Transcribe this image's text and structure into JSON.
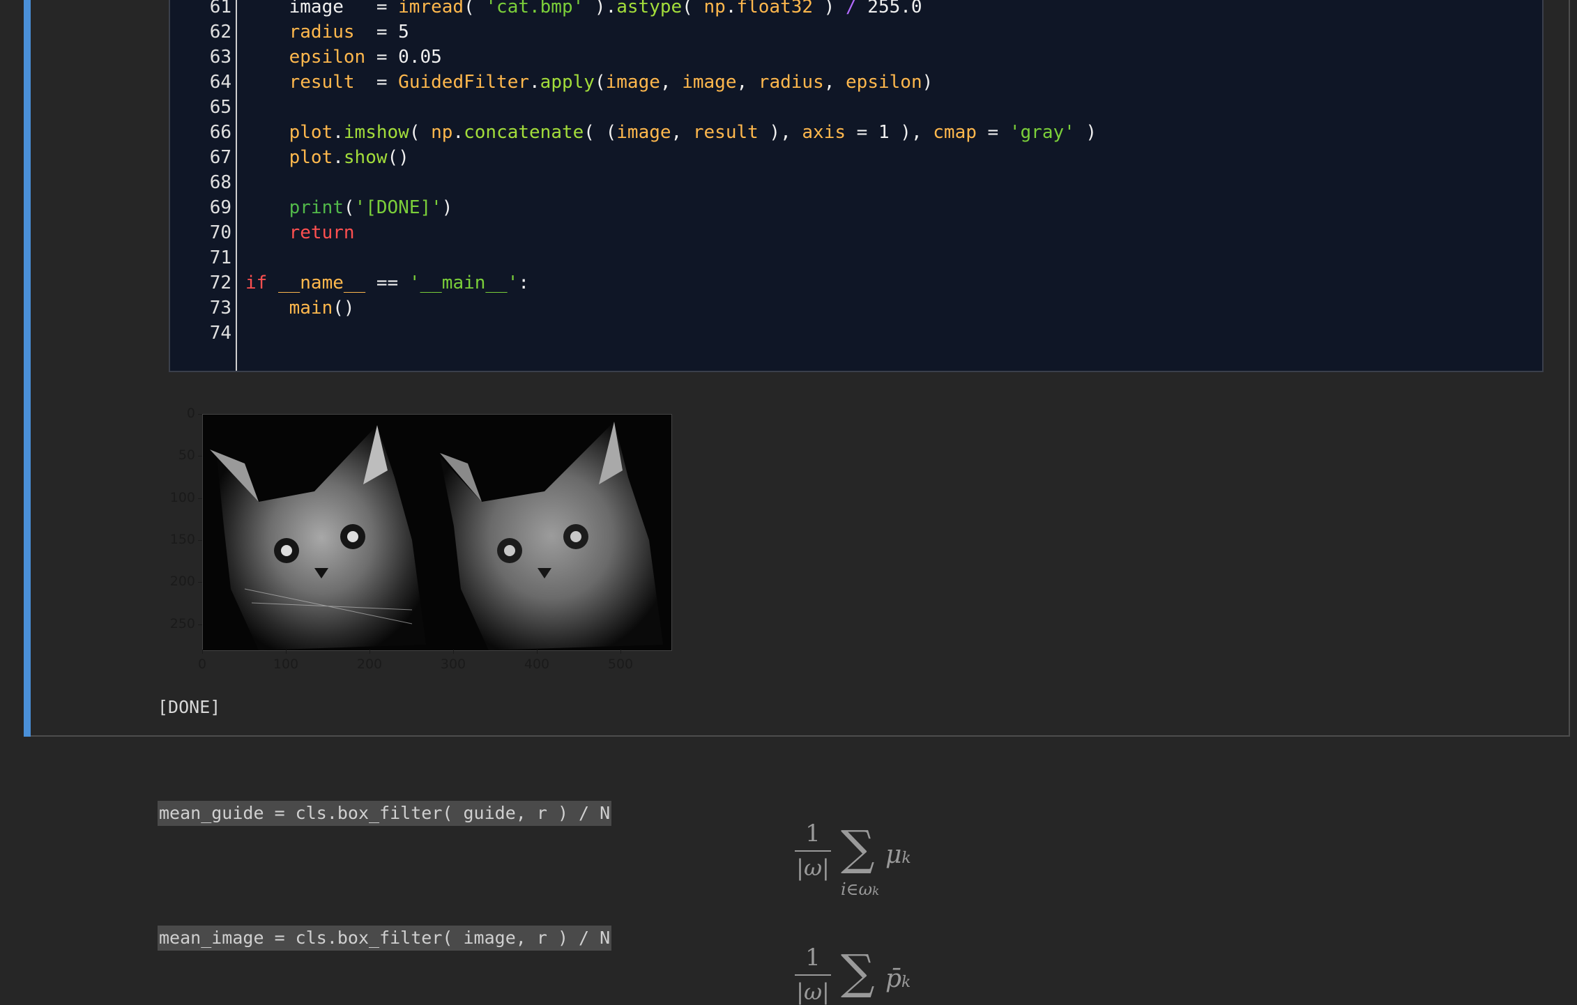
{
  "code": {
    "lines": [
      {
        "num": "61",
        "parts": [
          [
            "w",
            "    image   = "
          ],
          [
            "n",
            "imread"
          ],
          [
            "w",
            "( "
          ],
          [
            "s",
            "'cat.bmp'"
          ],
          [
            "w",
            " )."
          ],
          [
            "f",
            "astype"
          ],
          [
            "w",
            "( "
          ],
          [
            "n",
            "np"
          ],
          [
            "w",
            "."
          ],
          [
            "n",
            "float32"
          ],
          [
            "w",
            " ) "
          ],
          [
            "op",
            "/"
          ],
          [
            "w",
            " 255.0"
          ]
        ]
      },
      {
        "num": "62",
        "parts": [
          [
            "w",
            "    "
          ],
          [
            "n",
            "radius"
          ],
          [
            "w",
            "  = 5"
          ]
        ]
      },
      {
        "num": "63",
        "parts": [
          [
            "w",
            "    "
          ],
          [
            "n",
            "epsilon"
          ],
          [
            "w",
            " = 0.05"
          ]
        ]
      },
      {
        "num": "64",
        "parts": [
          [
            "w",
            "    "
          ],
          [
            "n",
            "result"
          ],
          [
            "w",
            "  = "
          ],
          [
            "n",
            "GuidedFilter"
          ],
          [
            "w",
            "."
          ],
          [
            "f",
            "apply"
          ],
          [
            "w",
            "("
          ],
          [
            "n",
            "image"
          ],
          [
            "w",
            ", "
          ],
          [
            "n",
            "image"
          ],
          [
            "w",
            ", "
          ],
          [
            "n",
            "radius"
          ],
          [
            "w",
            ", "
          ],
          [
            "n",
            "epsilon"
          ],
          [
            "w",
            ")"
          ]
        ]
      },
      {
        "num": "65",
        "parts": []
      },
      {
        "num": "66",
        "parts": [
          [
            "w",
            "    "
          ],
          [
            "n",
            "plot"
          ],
          [
            "w",
            "."
          ],
          [
            "f",
            "imshow"
          ],
          [
            "w",
            "( "
          ],
          [
            "n",
            "np"
          ],
          [
            "w",
            "."
          ],
          [
            "f",
            "concatenate"
          ],
          [
            "w",
            "( ("
          ],
          [
            "n",
            "image"
          ],
          [
            "w",
            ", "
          ],
          [
            "n",
            "result"
          ],
          [
            "w",
            " ), "
          ],
          [
            "n",
            "axis"
          ],
          [
            "w",
            " = 1 ), "
          ],
          [
            "n",
            "cmap"
          ],
          [
            "w",
            " = "
          ],
          [
            "s",
            "'gray'"
          ],
          [
            "w",
            " )"
          ]
        ]
      },
      {
        "num": "67",
        "parts": [
          [
            "w",
            "    "
          ],
          [
            "n",
            "plot"
          ],
          [
            "w",
            "."
          ],
          [
            "f",
            "show"
          ],
          [
            "w",
            "()"
          ]
        ]
      },
      {
        "num": "68",
        "parts": []
      },
      {
        "num": "69",
        "parts": [
          [
            "w",
            "    "
          ],
          [
            "b",
            "print"
          ],
          [
            "w",
            "("
          ],
          [
            "s",
            "'[DONE]'"
          ],
          [
            "w",
            ")"
          ]
        ]
      },
      {
        "num": "70",
        "parts": [
          [
            "w",
            "    "
          ],
          [
            "k",
            "return"
          ]
        ]
      },
      {
        "num": "71",
        "parts": []
      },
      {
        "num": "72",
        "parts": [
          [
            "k",
            "if"
          ],
          [
            "w",
            " "
          ],
          [
            "n",
            "__name__"
          ],
          [
            "w",
            " == "
          ],
          [
            "s",
            "'__main__'"
          ],
          [
            "w",
            ":"
          ]
        ]
      },
      {
        "num": "73",
        "parts": [
          [
            "w",
            "    "
          ],
          [
            "n",
            "main"
          ],
          [
            "w",
            "()"
          ]
        ]
      },
      {
        "num": "74",
        "parts": []
      }
    ]
  },
  "plot": {
    "yticks": [
      "0",
      "50",
      "100",
      "150",
      "200",
      "250"
    ],
    "xticks": [
      "0",
      "100",
      "200",
      "300",
      "400",
      "500"
    ],
    "image_description_icon": "cat-image-comparison"
  },
  "output": {
    "done_text": "[DONE]"
  },
  "markdown": {
    "code1": "mean_guide = cls.box_filter( guide, r ) / N",
    "code2": "mean_image = cls.box_filter( image, r ) / N",
    "eq1": {
      "num": "1",
      "den": "|ω|",
      "sub": "i∈ω",
      "subk": "k",
      "var": "μ",
      "vark": "k"
    },
    "eq2": {
      "num": "1",
      "den": "|ω|",
      "sub": "i∈ω",
      "subk": "k",
      "var": "p̄",
      "vark": "k"
    }
  },
  "colors": {
    "accent": "#4a90d9",
    "editor_bg": "#0f1626",
    "page_bg": "#262626"
  }
}
